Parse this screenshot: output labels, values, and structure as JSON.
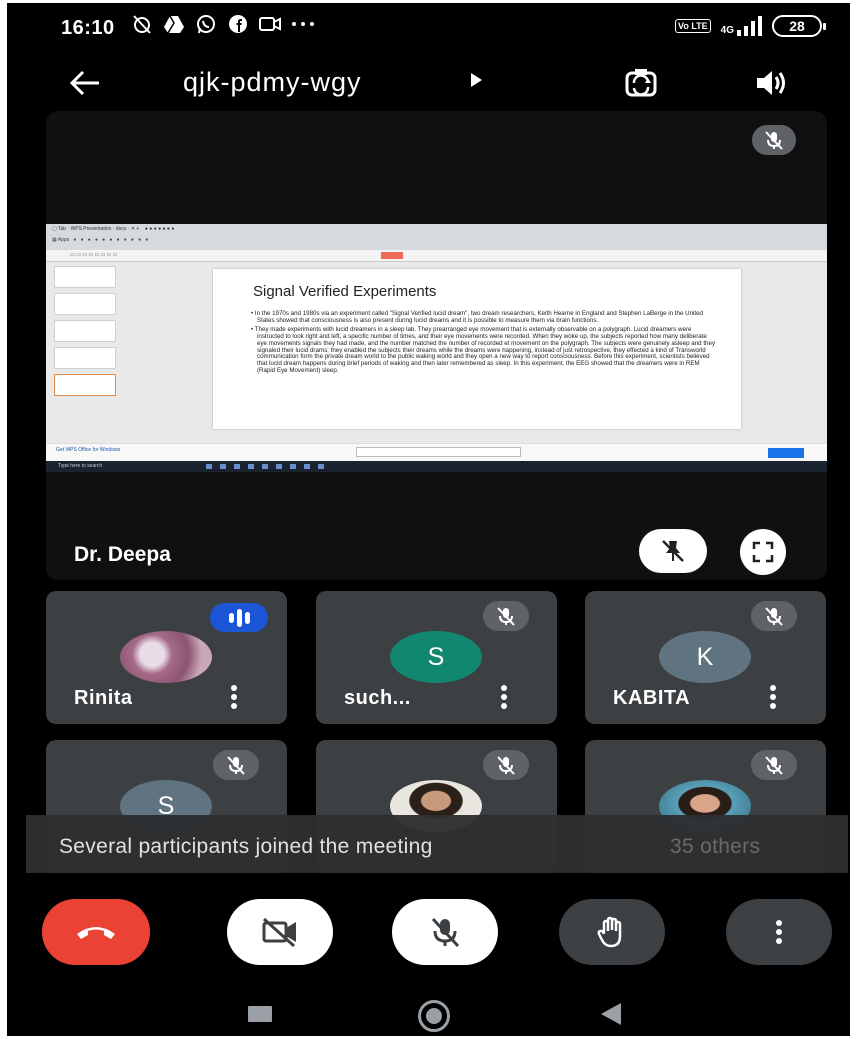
{
  "status_bar": {
    "time": "16:10",
    "network": "4G",
    "volte": "Vo LTE",
    "battery": "28"
  },
  "header": {
    "meeting_code": "qjk-pdmy-wgy",
    "icons": [
      "back-arrow-icon",
      "switch-camera-icon",
      "speaker-icon"
    ]
  },
  "presentation": {
    "presenter": "Dr. Deepa",
    "slide": {
      "title": "Signal Verified Experiments",
      "bullets": [
        "In the 1970s and 1980s via an experiment called \"Signal Verified lucid dream\", two dream researchers, Keith Hearne in England and Stephen LaBerge in the United States showed that consciousness is also present during lucid dreams and it is possible to measure them via brain functions.",
        "They made experiments with lucid dreamers in a sleep lab. They prearranged eye movement that is externally observable on a polygraph. Lucid dreamers were instructed to look right and left, a specific number of times, and their eye movements were recorded. When they woke up, the subjects reported how many deliberate eye movements signals they had made, and the number matched the number of recorded et movement on the polygraph. The subjects were genuinely asleep and they signaled their lucid drams; they enabled the subjects their dreams while the dreams were happening, instead of just retrospective, they effected a kind of Transworld communication form the private dream world to the public waking world and they open a new way to report consciousness. Before this experiment, scientists believed that lucid dream happens during brief periods of waking and then later remembered as sleep. In this experiment, the EEG showed that the dreamers were in REM (Rapid Eye Movement) sleep."
      ]
    },
    "download_bar_text": "Get WPS Office for Windows",
    "taskbar_text": "Type here to search"
  },
  "participants": [
    {
      "name": "Rinita",
      "initial": "",
      "avatar_color": "#b79aa6",
      "muted": false,
      "speaking": true
    },
    {
      "name": "such...",
      "initial": "S",
      "avatar_color": "#12876f",
      "muted": true,
      "speaking": false
    },
    {
      "name": "KABITA",
      "initial": "K",
      "avatar_color": "#5f7380",
      "muted": true,
      "speaking": false
    },
    {
      "name": "",
      "initial": "S",
      "avatar_color": "#5f7380",
      "muted": true,
      "speaking": false
    },
    {
      "name": "",
      "initial": "",
      "avatar_color": "#d7d4cc",
      "muted": true,
      "speaking": false
    },
    {
      "name": "",
      "initial": "",
      "avatar_color": "#5aa0b8",
      "muted": true,
      "speaking": false
    }
  ],
  "toast": {
    "message": "Several participants joined the meeting",
    "others": "35 others"
  },
  "controls": [
    "end-call-icon",
    "camera-off-icon",
    "mic-off-icon",
    "raise-hand-icon",
    "more-options-icon"
  ],
  "colors": {
    "end_call": "#ea4335",
    "tile_bg": "#3c4043",
    "speaking_badge": "#1a56d6",
    "badge_grey": "#5f6368"
  }
}
